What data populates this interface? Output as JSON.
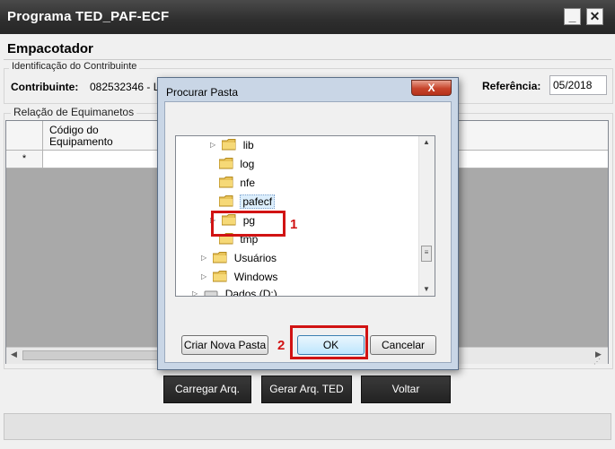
{
  "window": {
    "title": "Programa TED_PAF-ECF",
    "minimize_label": "_",
    "close_label": "✕"
  },
  "main": {
    "section_title": "Empacotador",
    "group_contrib_label": "Identificação do Contribuinte",
    "contribuinte_label": "Contribuinte:",
    "contribuinte_value": "082532346 - L F",
    "referencia_label": "Referência:",
    "referencia_value": "05/2018",
    "group_equip_label": "Relação de Equimanetos",
    "grid": {
      "columns": [
        "Código do Equipamento"
      ],
      "new_row_marker": "*"
    },
    "buttons": {
      "carregar": "Carregar Arq.",
      "gerar": "Gerar Arq. TED",
      "voltar": "Voltar"
    }
  },
  "dialog": {
    "title": "Procurar Pasta",
    "close_label": "X",
    "tree_items": [
      {
        "label": "lib",
        "expandable": true
      },
      {
        "label": "log",
        "expandable": false
      },
      {
        "label": "nfe",
        "expandable": false
      },
      {
        "label": "pafecf",
        "expandable": false,
        "selected": true
      },
      {
        "label": "pg",
        "expandable": true
      },
      {
        "label": "tmp",
        "expandable": false
      },
      {
        "label": "Usuários",
        "expandable": true
      },
      {
        "label": "Windows",
        "expandable": true
      },
      {
        "label": "Dados (D:)",
        "expandable": true
      }
    ],
    "buttons": {
      "new_folder": "Criar Nova Pasta",
      "ok": "OK",
      "cancel": "Cancelar"
    }
  },
  "annotations": {
    "step1": "1",
    "step2": "2",
    "color": "#d11313"
  }
}
